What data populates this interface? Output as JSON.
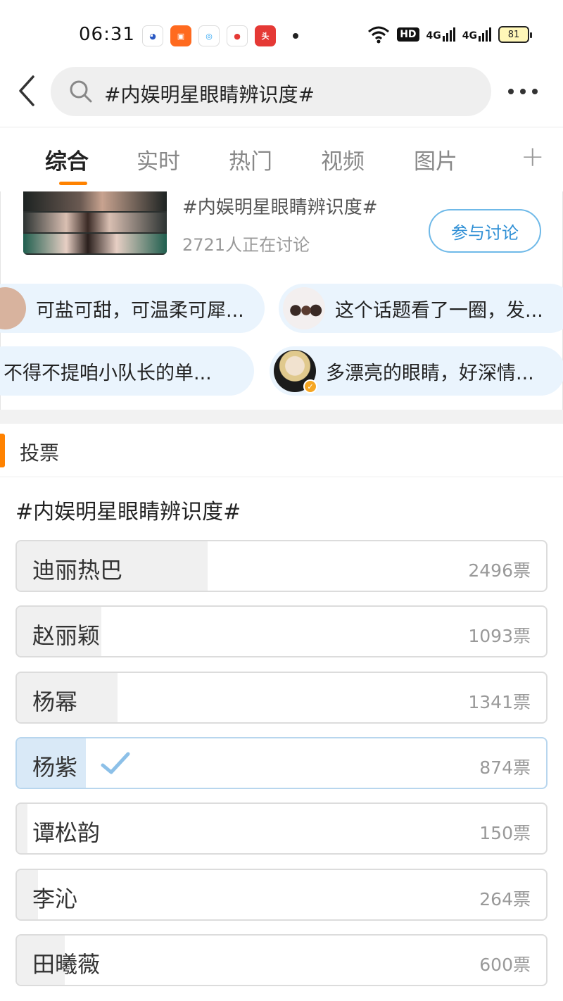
{
  "status_bar": {
    "time": "06:31",
    "wifi_icon": "wifi-icon",
    "hd_label": "HD",
    "signal1": "4G",
    "signal2": "4G",
    "battery": "81"
  },
  "header": {
    "back_icon": "chevron-left-icon",
    "search_icon": "search-icon",
    "search_text": "#内娱明星眼睛辨识度#",
    "more_icon": "more-horizontal-icon"
  },
  "tabs": [
    {
      "label": "综合",
      "active": true
    },
    {
      "label": "实时",
      "active": false
    },
    {
      "label": "热门",
      "active": false
    },
    {
      "label": "视频",
      "active": false
    },
    {
      "label": "图片",
      "active": false
    }
  ],
  "tab_add_icon": "plus-icon",
  "topic": {
    "title": "#内娱明星眼睛辨识度#",
    "count": "2721人正在讨论",
    "join_label": "参与讨论"
  },
  "pills": [
    {
      "text": "可盐可甜，可温柔可犀..."
    },
    {
      "text": "这个话题看了一圈，发..."
    },
    {
      "text": "不得不提咱小队长的单..."
    },
    {
      "text": "多漂亮的眼睛，好深情..."
    }
  ],
  "vote": {
    "section_label": "投票",
    "title": "#内娱明星眼睛辨识度#",
    "options": [
      {
        "name": "迪丽热巴",
        "votes": "2496票",
        "fraction": 0.36,
        "selected": false
      },
      {
        "name": "赵丽颖",
        "votes": "1093票",
        "fraction": 0.16,
        "selected": false
      },
      {
        "name": "杨幂",
        "votes": "1341票",
        "fraction": 0.19,
        "selected": false
      },
      {
        "name": "杨紫",
        "votes": "874票",
        "fraction": 0.13,
        "selected": true
      },
      {
        "name": "谭松韵",
        "votes": "150票",
        "fraction": 0.02,
        "selected": false
      },
      {
        "name": "李沁",
        "votes": "264票",
        "fraction": 0.04,
        "selected": false
      },
      {
        "name": "田曦薇",
        "votes": "600票",
        "fraction": 0.09,
        "selected": false
      }
    ]
  },
  "colors": {
    "accent": "#ff8200",
    "link": "#2e8fd5",
    "pill_bg": "#eaf4fd",
    "selected_fill": "#d9e9f7"
  }
}
